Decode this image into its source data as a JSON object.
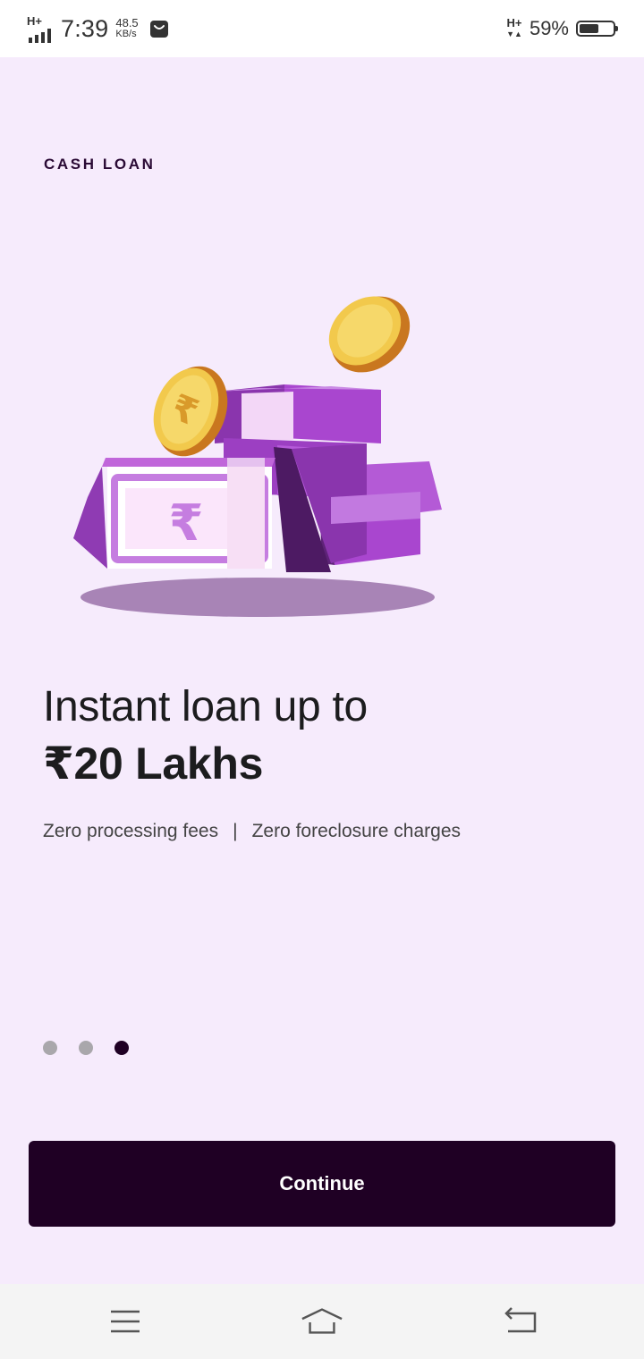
{
  "status_bar": {
    "network_type": "H+",
    "time": "7:39",
    "speed_value": "48.5",
    "speed_unit": "KB/s",
    "network_type_right": "H+",
    "battery_percent": "59%",
    "battery_level": 0.59
  },
  "eyebrow": "CASH LOAN",
  "headline": {
    "line1": "Instant loan up to",
    "line2": "₹20 Lakhs"
  },
  "features": {
    "item1": "Zero processing fees",
    "separator": "|",
    "item2": "Zero foreclosure charges"
  },
  "pagination": {
    "total": 3,
    "active_index": 2
  },
  "continue_label": "Continue",
  "colors": {
    "background": "#f6ebfc",
    "primary_dark": "#1f0024",
    "accent_purple": "#a94fc9"
  },
  "nav_icons": [
    "menu-icon",
    "home-icon",
    "back-icon"
  ]
}
